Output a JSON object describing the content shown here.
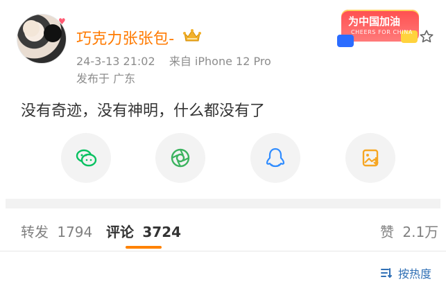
{
  "post": {
    "username": "巧克力张张包-",
    "timestamp": "24-3-13 21:02",
    "source": "来自 iPhone 12 Pro",
    "location": "发布于 广东",
    "content": "没有奇迹，没有神明，什么都没有了"
  },
  "promo": {
    "title": "为中国加油",
    "subtitle": "CHEERS FOR CHINA"
  },
  "share": {
    "icons": [
      "wechat-icon",
      "moments-icon",
      "qq-icon",
      "save-image-icon"
    ]
  },
  "tabs": {
    "repost_label": "转发",
    "repost_count": "1794",
    "comment_label": "评论",
    "comment_count": "3724",
    "like_label": "赞",
    "like_count": "2.1万"
  },
  "sort": {
    "label": "按热度"
  },
  "colors": {
    "username": "#ff7a00",
    "accent": "#ff8200",
    "wechat": "#07c160",
    "moments": "#3cb35f",
    "qq": "#2f8cff",
    "save": "#f6a623",
    "sort": "#2f6fb5"
  }
}
